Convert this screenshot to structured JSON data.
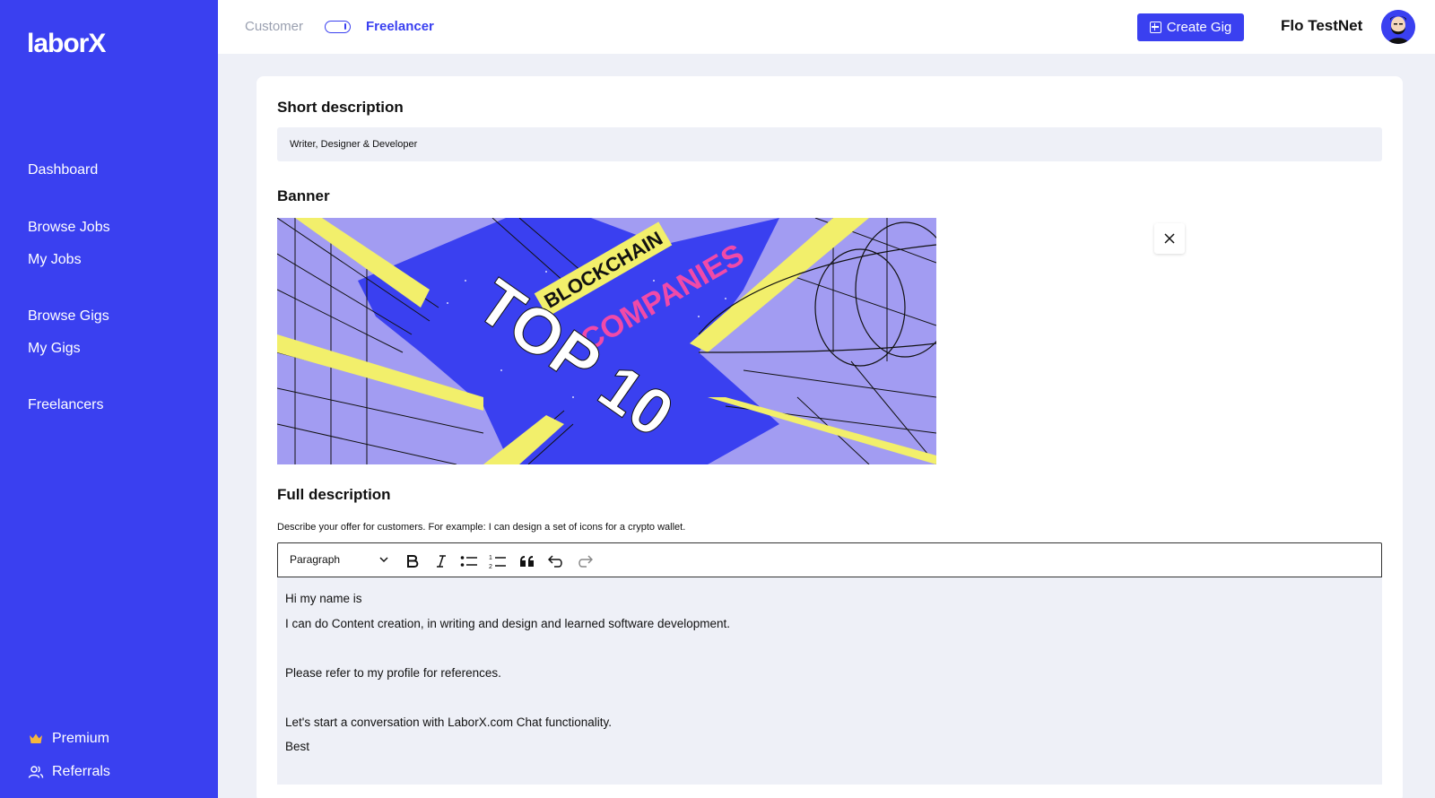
{
  "sidebar": {
    "logo": "laborX",
    "items": [
      {
        "label": "Dashboard"
      },
      {
        "label": "Browse Jobs"
      },
      {
        "label": "My Jobs"
      },
      {
        "label": "Browse Gigs"
      },
      {
        "label": "My Gigs"
      },
      {
        "label": "Freelancers"
      }
    ],
    "bottom": [
      {
        "label": "Premium",
        "icon": "crown-icon"
      },
      {
        "label": "Referrals",
        "icon": "users-icon"
      }
    ]
  },
  "topbar": {
    "mode_customer": "Customer",
    "mode_freelancer": "Freelancer",
    "active_mode": "Freelancer",
    "create_gig_label": "Create Gig",
    "username": "Flo TestNet"
  },
  "form": {
    "short_description": {
      "title": "Short description",
      "value": "Writer, Designer & Developer"
    },
    "banner": {
      "title": "Banner",
      "image_text": {
        "line1": "BLOCKCHAIN",
        "line2": "COMPANIES",
        "line3": "TOP 10"
      }
    },
    "full_description": {
      "title": "Full description",
      "hint": "Describe your offer for customers. For example: I can design a set of icons for a crypto wallet.",
      "block_format": "Paragraph",
      "lines": [
        "Hi my name is",
        "I can do Content creation, in writing and design and learned software development.",
        "",
        "Please refer to my profile for references.",
        "",
        "Let's start a conversation with LaborX.com Chat functionality.",
        "Best"
      ]
    }
  },
  "colors": {
    "brand": "#3a40f0",
    "background": "#eef0f7",
    "banner_bg": "#a29cf2",
    "banner_yellow": "#f2ef6b",
    "banner_pink": "#f04aa8"
  }
}
